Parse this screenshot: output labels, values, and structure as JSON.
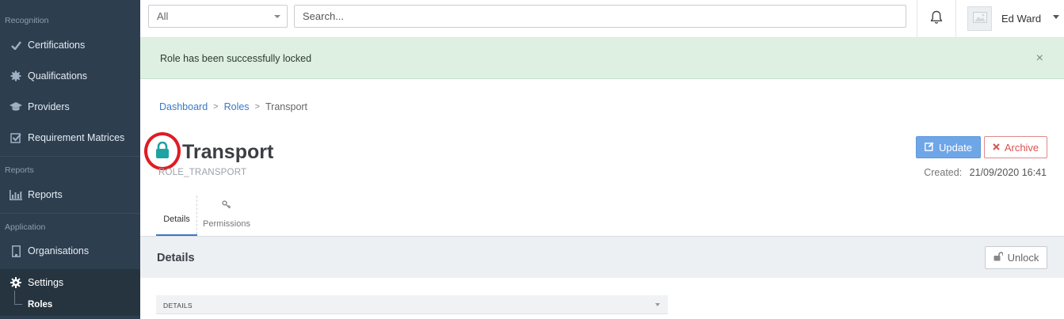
{
  "sidebar": {
    "sections": {
      "recognition": "Recognition",
      "reports": "Reports",
      "application": "Application"
    },
    "items": {
      "certifications": "Certifications",
      "qualifications": "Qualifications",
      "providers": "Providers",
      "requirement_matrices": "Requirement Matrices",
      "reports": "Reports",
      "organisations": "Organisations",
      "settings": "Settings"
    },
    "sub_items": {
      "roles": "Roles"
    }
  },
  "topbar": {
    "filter_selected": "All",
    "search_placeholder": "Search...",
    "user_name": "Ed Ward"
  },
  "alert": {
    "message": "Role has been successfully locked",
    "close_glyph": "×"
  },
  "breadcrumb": {
    "items": [
      "Dashboard",
      "Roles"
    ],
    "current": "Transport",
    "separator": ">"
  },
  "role": {
    "title": "Transport",
    "code": "ROLE_TRANSPORT",
    "locked": true,
    "created_label": "Created:",
    "created_value": "21/09/2020 16:41"
  },
  "actions": {
    "update": "Update",
    "archive": "Archive",
    "unlock": "Unlock"
  },
  "tabs": {
    "details": "Details",
    "permissions": "Permissions"
  },
  "panel": {
    "title": "Details",
    "subpanel_title": "DETAILS"
  },
  "colors": {
    "sidebar_bg": "#2d3e4f",
    "accent_blue": "#3a78c7",
    "success_bg": "#ddf0e1",
    "lock_teal": "#1fa2a2",
    "highlight_red": "#e01b24",
    "archive_red": "#d9534f"
  },
  "icons": {
    "certifications": "check-icon",
    "qualifications": "badge-icon",
    "providers": "graduation-cap-icon",
    "requirement_matrices": "checkbox-icon",
    "reports": "bar-chart-icon",
    "organisations": "building-icon",
    "settings": "gear-icon",
    "bell": "bell-icon",
    "avatar": "image-placeholder-icon",
    "lock": "lock-icon",
    "update": "edit-icon",
    "archive": "x-icon",
    "unlock": "unlock-icon",
    "permissions": "key-icon"
  }
}
